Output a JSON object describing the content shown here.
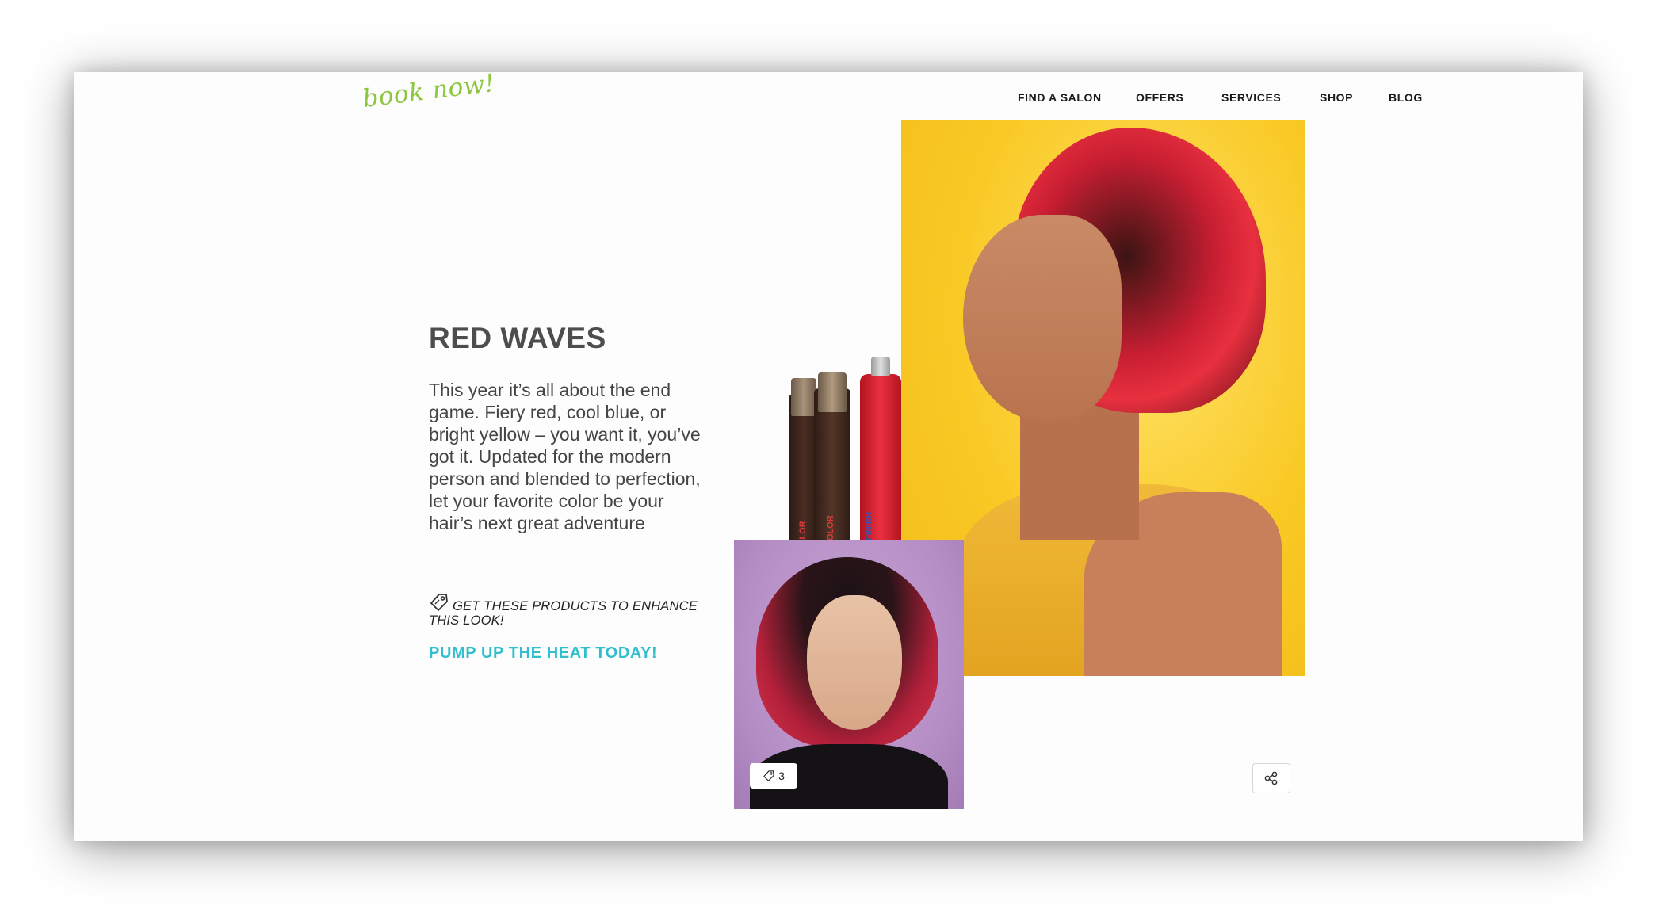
{
  "brand": {
    "logo_text": "book now!"
  },
  "nav": {
    "items": [
      {
        "label": "FIND A SALON"
      },
      {
        "label": "OFFERS"
      },
      {
        "label": "SERVICES"
      },
      {
        "label": "SHOP"
      },
      {
        "label": "BLOG"
      }
    ]
  },
  "look": {
    "title": "RED WAVES",
    "description": "This year it’s all about the end game. Fiery red, cool blue, or bright yellow – you want it, you’ve got it. Updated for the modern person and blended to perfection, let your favorite color be your hair’s next great adventure",
    "products_prompt": "GET THESE PRODUCTS TO ENHANCE THIS LOOK!",
    "cta": "PUMP UP THE HEAT TODAY!"
  },
  "products": {
    "bottle1_label": "COLOR",
    "bottle2_label": "COLOR",
    "bottle3_label": "FINISH"
  },
  "gallery": {
    "tag_count": "3"
  },
  "icons": {
    "tag": "tag-icon",
    "share": "share-icon"
  },
  "colors": {
    "brand_green": "#8dc63f",
    "cta_teal": "#31bfcd",
    "title_gray": "#4d4d4d"
  }
}
